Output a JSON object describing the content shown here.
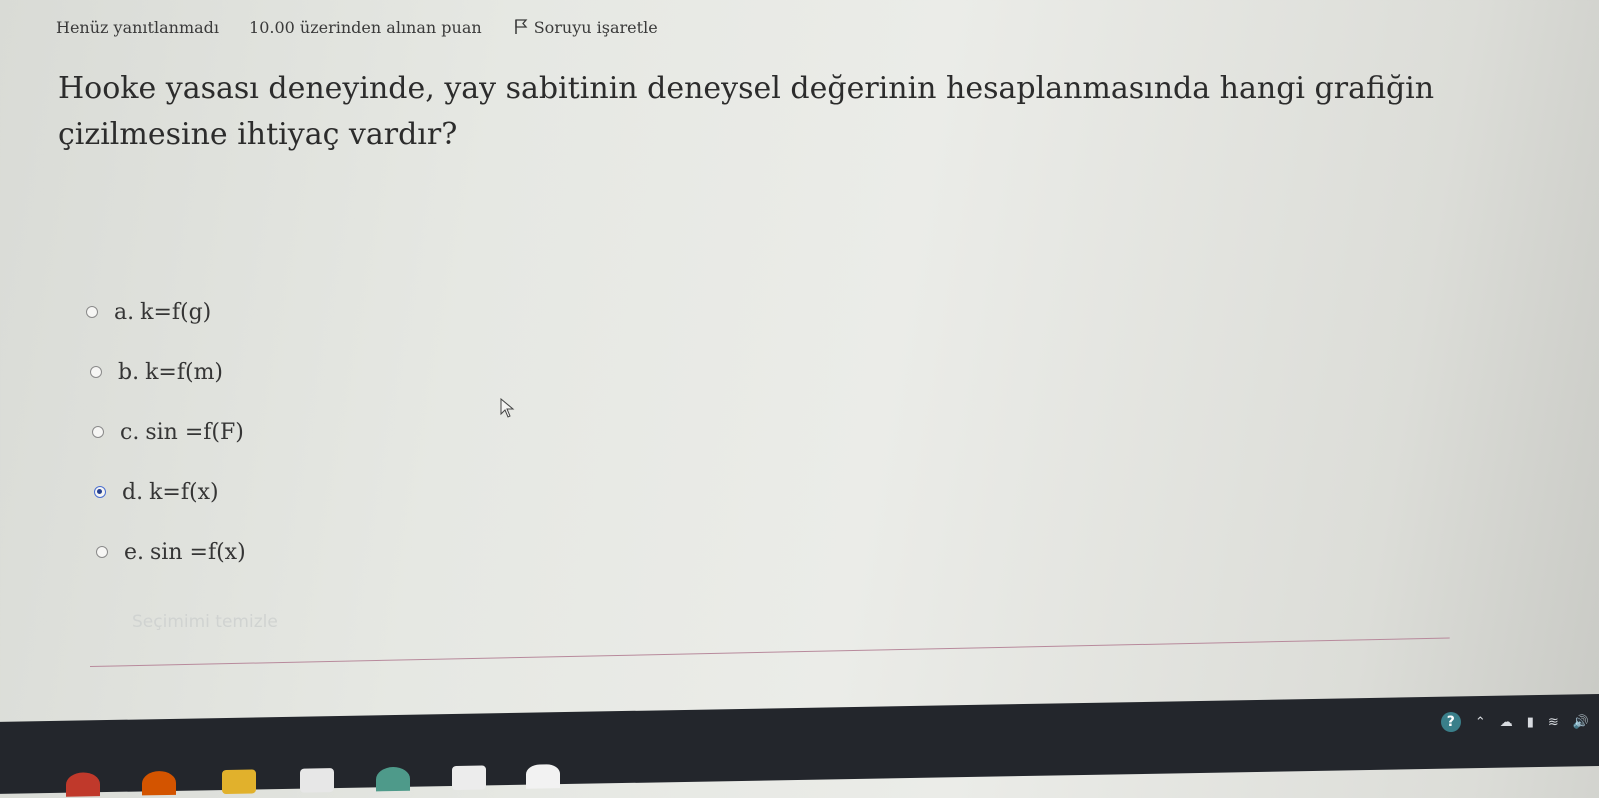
{
  "header": {
    "status": "Henüz yanıtlanmadı",
    "grade": "10.00 üzerinden alınan puan",
    "flag_label": "Soruyu işaretle",
    "flag_icon": "flag-icon"
  },
  "question": {
    "text": "Hooke yasası deneyinde, yay sabitinin deneysel değerinin hesaplanmasında hangi grafiğin çizilmesine ihtiyaç vardır?"
  },
  "options": [
    {
      "letter": "a.",
      "text": "k=f(g)",
      "selected": false
    },
    {
      "letter": "b.",
      "text": "k=f(m)",
      "selected": false
    },
    {
      "letter": "c.",
      "text": "sin =f(F)",
      "selected": false
    },
    {
      "letter": "d.",
      "text": "k=f(x)",
      "selected": true
    },
    {
      "letter": "e.",
      "text": "sin =f(x)",
      "selected": false
    }
  ],
  "clear_choice_label": "Seçimimi temizle",
  "taskbar": {
    "icons": [
      "chrome-icon",
      "chrome-icon",
      "file-explorer-icon",
      "store-icon",
      "app-icon",
      "intellij-icon",
      "app-icon"
    ],
    "tray_icons": [
      "help-icon",
      "chevron-up-icon",
      "cloud-icon",
      "battery-icon",
      "network-icon",
      "volume-icon"
    ]
  },
  "colors": {
    "selected_radio": "#26408f",
    "taskbar": "#23262c"
  }
}
